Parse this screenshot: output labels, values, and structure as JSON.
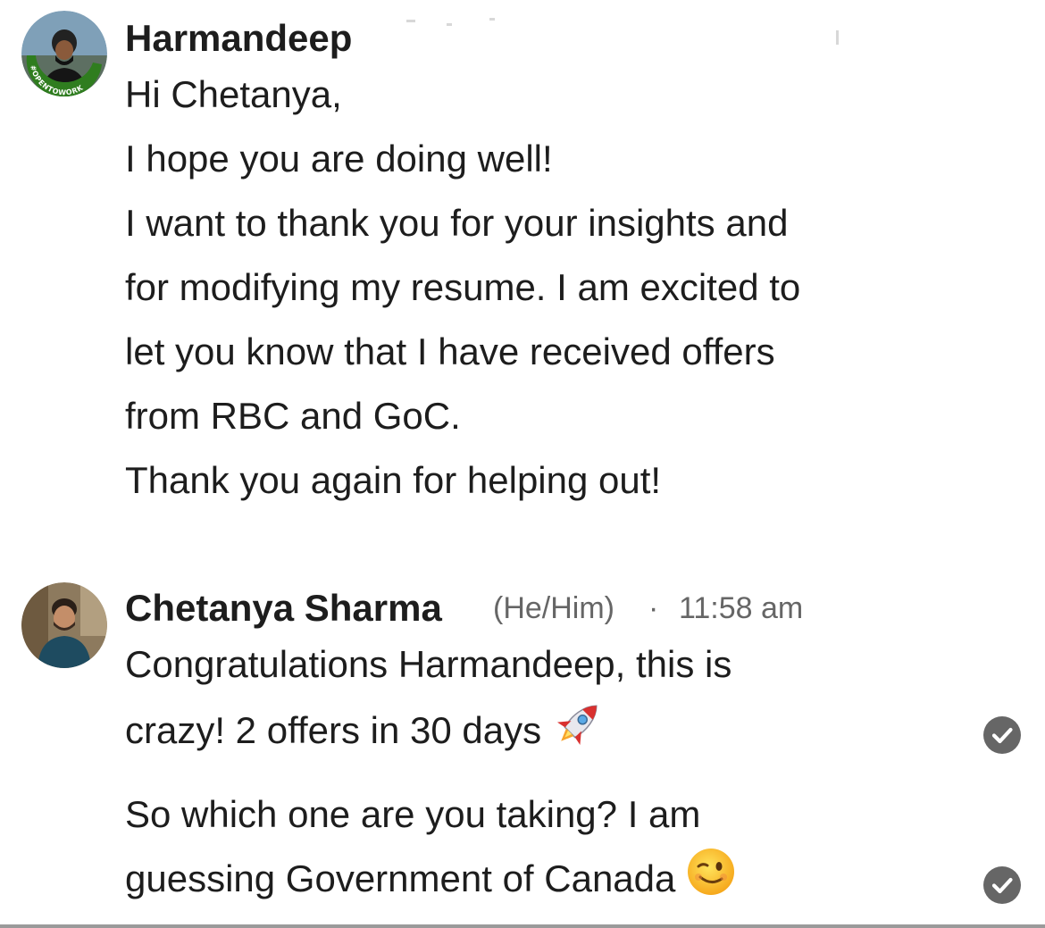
{
  "conversation": {
    "messages": [
      {
        "sender": "Harmandeep",
        "avatar_badge": "#OPENTOWORK",
        "lines": [
          "Hi Chetanya,",
          "I hope you are doing well!",
          "I want to thank you for your insights and",
          "for modifying my resume. I am excited to",
          "let you know that I have received offers",
          "from RBC and GoC.",
          "Thank you again for helping out!"
        ]
      },
      {
        "sender": "Chetanya Sharma",
        "pronouns": "(He/Him)",
        "separator": "·",
        "time": "11:58 am",
        "bubbles": [
          {
            "lines": [
              "Congratulations Harmandeep, this is",
              "crazy! 2 offers in 30 days"
            ],
            "emoji": "rocket-emoji",
            "status": "seen-check"
          },
          {
            "lines": [
              "So which one are you taking? I am",
              "guessing Government of Canada"
            ],
            "emoji": "winking-face-emoji",
            "status": "seen-check"
          }
        ]
      }
    ]
  },
  "colors": {
    "text": "#1d1d1d",
    "meta": "#666666",
    "badge_green": "#2f7d1f",
    "check_bg": "#666666"
  }
}
